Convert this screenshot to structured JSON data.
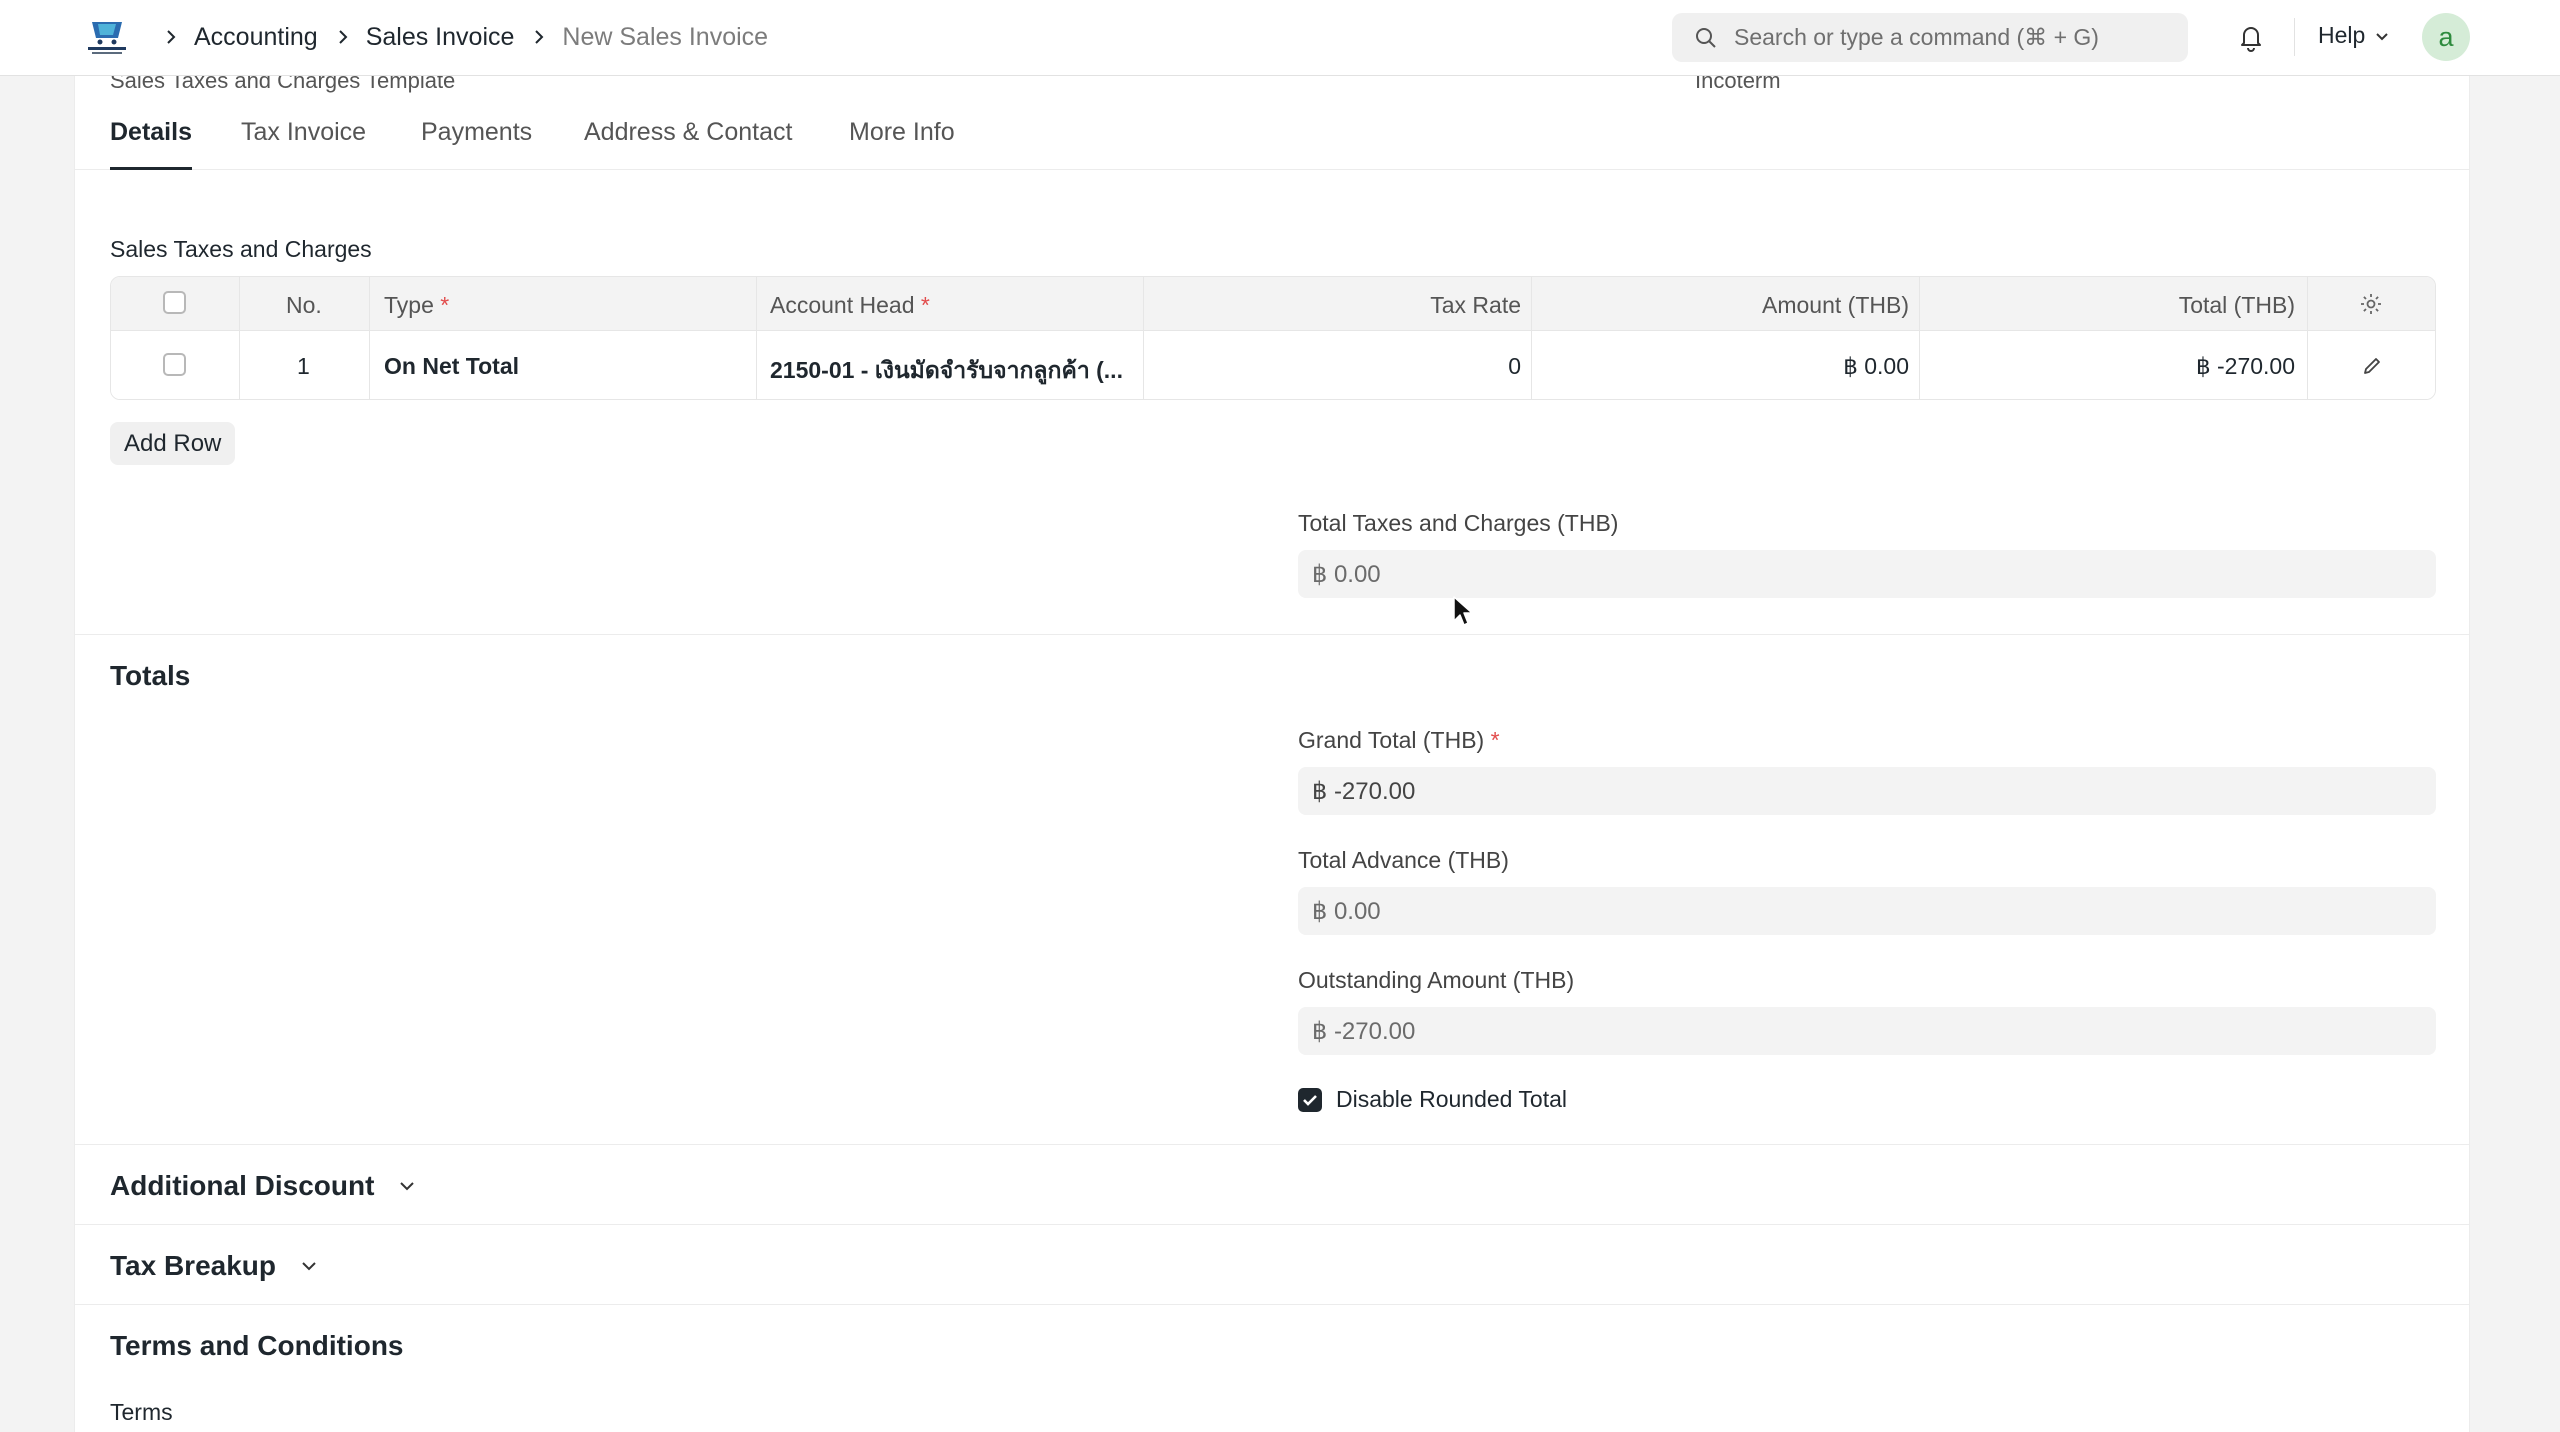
{
  "navbar": {
    "breadcrumbs": [
      "Accounting",
      "Sales Invoice",
      "New Sales Invoice"
    ],
    "search_placeholder": "Search or type a command (⌘ + G)",
    "help_label": "Help",
    "avatar_letter": "a"
  },
  "header_cut": {
    "left_label": "Sales Taxes and Charges Template",
    "right_label": "Incoterm"
  },
  "tabs": [
    "Details",
    "Tax Invoice",
    "Payments",
    "Address & Contact",
    "More Info"
  ],
  "taxes": {
    "section_label": "Sales Taxes and Charges",
    "columns": {
      "no": "No.",
      "type": "Type",
      "account_head": "Account Head",
      "tax_rate": "Tax Rate",
      "amount": "Amount (THB)",
      "total": "Total (THB)"
    },
    "required_mark": "*",
    "rows": [
      {
        "no": "1",
        "type": "On Net Total",
        "account_head": "2150-01 - เงินมัดจำรับจากลูกค้า (...",
        "tax_rate": "0",
        "amount": "฿ 0.00",
        "total": "฿ -270.00"
      }
    ],
    "add_row_label": "Add Row",
    "total_taxes_label": "Total Taxes and Charges (THB)",
    "total_taxes_value": "฿ 0.00"
  },
  "totals": {
    "title": "Totals",
    "grand_total_label": "Grand Total (THB)",
    "grand_total_value": "฿ -270.00",
    "total_advance_label": "Total Advance (THB)",
    "total_advance_value": "฿ 0.00",
    "outstanding_label": "Outstanding Amount (THB)",
    "outstanding_value": "฿ -270.00",
    "disable_rounded_label": "Disable Rounded Total",
    "disable_rounded_checked": true
  },
  "sections": {
    "additional_discount": "Additional Discount",
    "tax_breakup": "Tax Breakup",
    "terms_and_conditions": "Terms and Conditions",
    "terms_label": "Terms"
  },
  "colors": {
    "accent_dark": "#1f272e",
    "required": "#e24c4c",
    "avatar_bg": "#d5ecd7",
    "avatar_fg": "#2e8b3e"
  }
}
